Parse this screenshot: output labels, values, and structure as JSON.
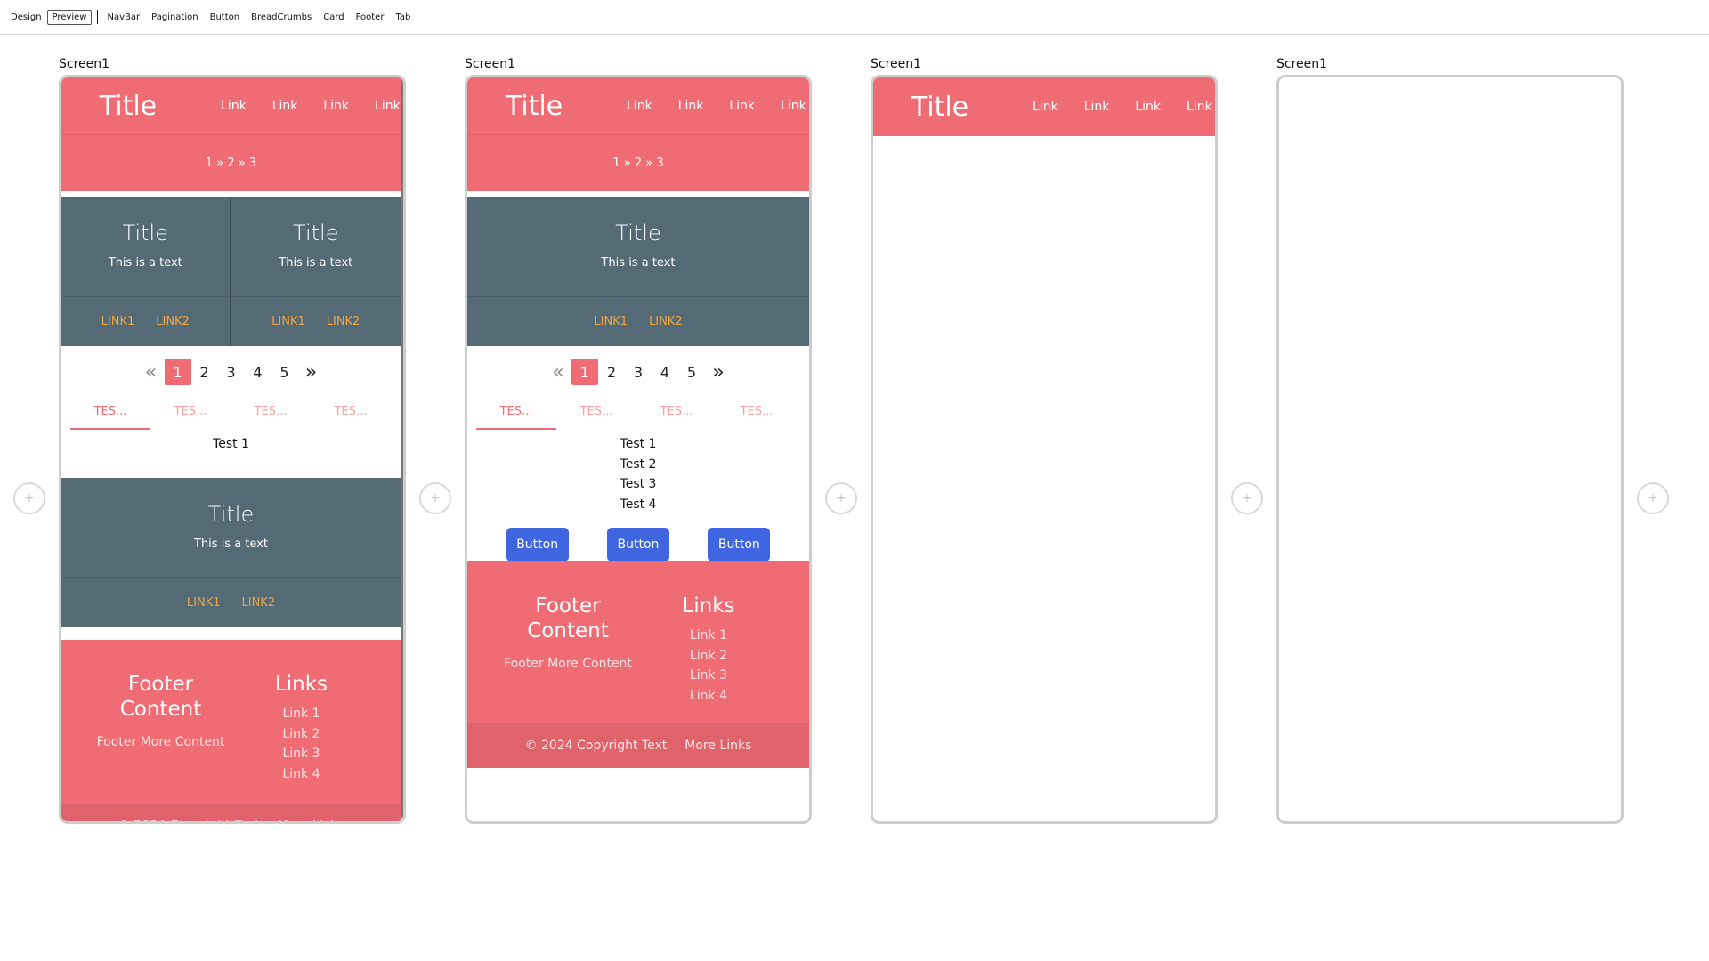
{
  "toolbar": {
    "design": "Design",
    "preview": "Preview",
    "components": [
      "NavBar",
      "Pagination",
      "Button",
      "BreadCrumbs",
      "Card",
      "Footer",
      "Tab"
    ]
  },
  "screen_label": "Screen1",
  "add_symbol": "+",
  "navbar": {
    "title": "Title",
    "links": [
      "Link",
      "Link",
      "Link",
      "Link"
    ]
  },
  "breadcrumbs": {
    "items": [
      "1",
      "2",
      "3"
    ],
    "separator": "»"
  },
  "card": {
    "title": "Title",
    "text": "This is a text",
    "links": [
      "LINK1",
      "LINK2"
    ]
  },
  "pagination": {
    "prev": "«",
    "next": "»",
    "pages": [
      "1",
      "2",
      "3",
      "4",
      "5"
    ],
    "active": "1"
  },
  "tabs": {
    "labels": [
      "TES...",
      "TES...",
      "TES...",
      "TES..."
    ],
    "active_index": 0
  },
  "tab_content_screen1": [
    "Test 1"
  ],
  "tab_content_screen2": [
    "Test 1",
    "Test 2",
    "Test 3",
    "Test 4"
  ],
  "buttons": [
    "Button",
    "Button",
    "Button"
  ],
  "footer": {
    "heading": "Footer Content",
    "text": "Footer More Content",
    "links_heading": "Links",
    "links": [
      "Link 1",
      "Link 2",
      "Link 3",
      "Link 4"
    ],
    "copyright": "© 2024 Copyright Text",
    "more_links": "More Links"
  },
  "colors": {
    "primary": "#ef6c74",
    "card": "#546a75",
    "card_link": "#f0a540",
    "button": "#3f66e0"
  }
}
